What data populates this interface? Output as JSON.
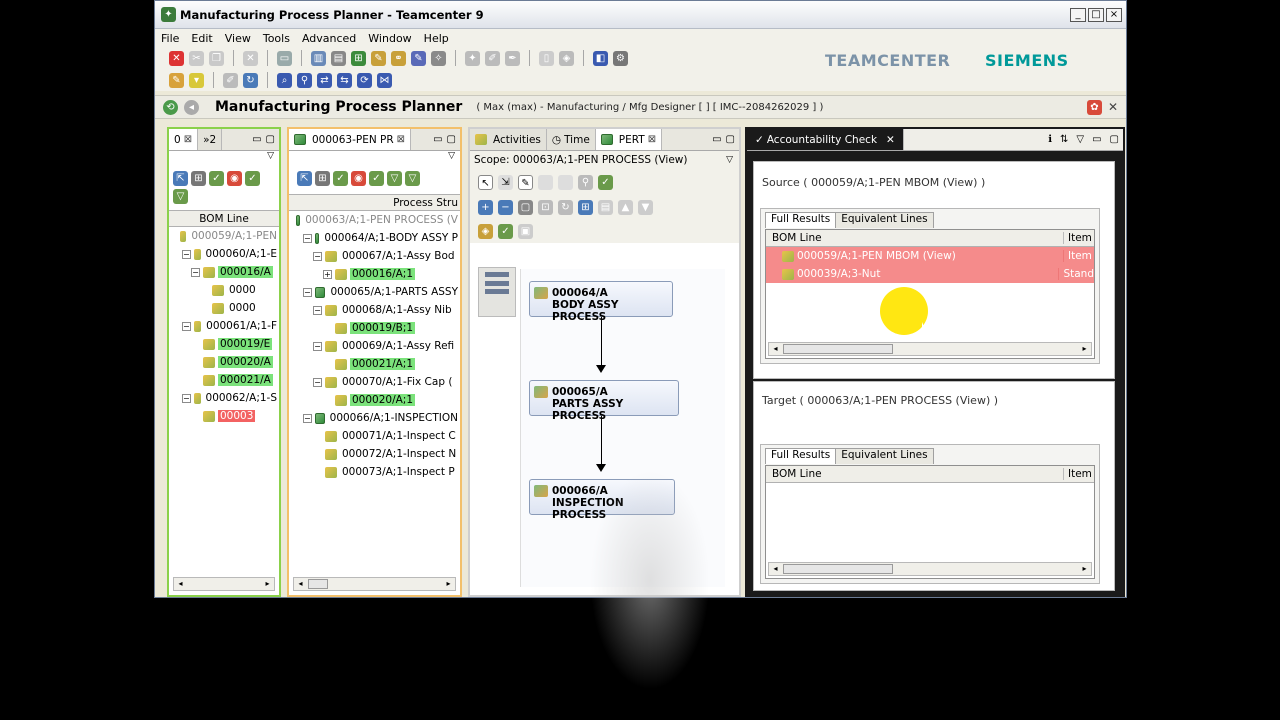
{
  "window": {
    "title": "Manufacturing Process Planner - Teamcenter 9"
  },
  "menu": [
    "File",
    "Edit",
    "View",
    "Tools",
    "Advanced",
    "Window",
    "Help"
  ],
  "brand": {
    "product": "TEAMCENTER",
    "company": "SIEMENS"
  },
  "appbar": {
    "name": "Manufacturing Process Planner",
    "context": "( Max (max) - Manufacturing / Mfg Designer   [ ]   [ IMC--2084262029 ] )"
  },
  "pane1": {
    "tabs": [
      "0",
      "»2"
    ],
    "header": "BOM Line",
    "rows": [
      {
        "label": "000059/A;1-PEN",
        "indent": 0,
        "style": "grey"
      },
      {
        "label": "000060/A;1-E",
        "indent": 1,
        "toggle": "−"
      },
      {
        "label": "000016/A",
        "indent": 2,
        "toggle": "−",
        "style": "green"
      },
      {
        "label": "0000",
        "indent": 3
      },
      {
        "label": "0000",
        "indent": 3
      },
      {
        "label": "000061/A;1-F",
        "indent": 1,
        "toggle": "−"
      },
      {
        "label": "000019/E",
        "indent": 2,
        "style": "green"
      },
      {
        "label": "000020/A",
        "indent": 2,
        "style": "green"
      },
      {
        "label": "000021/A",
        "indent": 2,
        "style": "green"
      },
      {
        "label": "000062/A;1-S",
        "indent": 1,
        "toggle": "−"
      },
      {
        "label": "00003",
        "indent": 2,
        "style": "red"
      }
    ]
  },
  "pane2": {
    "tab": "000063-PEN PR",
    "header": "Process Stru",
    "rows": [
      {
        "label": "000063/A;1-PEN PROCESS (V",
        "indent": 0,
        "style": "grey"
      },
      {
        "label": "000064/A;1-BODY ASSY P",
        "indent": 1,
        "toggle": "−"
      },
      {
        "label": "000067/A;1-Assy Bod",
        "indent": 2,
        "toggle": "−"
      },
      {
        "label": "000016/A;1",
        "indent": 3,
        "toggle": "+",
        "style": "green"
      },
      {
        "label": "000065/A;1-PARTS ASSY",
        "indent": 1,
        "toggle": "−"
      },
      {
        "label": "000068/A;1-Assy Nib",
        "indent": 2,
        "toggle": "−"
      },
      {
        "label": "000019/B;1",
        "indent": 3,
        "style": "green"
      },
      {
        "label": "000069/A;1-Assy Refi",
        "indent": 2,
        "toggle": "−"
      },
      {
        "label": "000021/A;1",
        "indent": 3,
        "style": "green"
      },
      {
        "label": "000070/A;1-Fix Cap (",
        "indent": 2,
        "toggle": "−"
      },
      {
        "label": "000020/A;1",
        "indent": 3,
        "style": "green"
      },
      {
        "label": "000066/A;1-INSPECTION",
        "indent": 1,
        "toggle": "−"
      },
      {
        "label": "000071/A;1-Inspect C",
        "indent": 2
      },
      {
        "label": "000072/A;1-Inspect N",
        "indent": 2
      },
      {
        "label": "000073/A;1-Inspect P",
        "indent": 2
      }
    ]
  },
  "pane3": {
    "tabs": [
      "Activities",
      "Time",
      "PERT"
    ],
    "scope": "Scope: 000063/A;1-PEN PROCESS (View)",
    "nodes": [
      {
        "id": "000064/A",
        "name": "BODY ASSY PROCESS"
      },
      {
        "id": "000065/A",
        "name": "PARTS ASSY PROCESS"
      },
      {
        "id": "000066/A",
        "name": "INSPECTION PROCESS"
      }
    ]
  },
  "pane4": {
    "tab": "Accountability Check",
    "source": {
      "title": "Source ( 000059/A;1-PEN MBOM (View) )",
      "tabs": [
        "Full Results",
        "Equivalent Lines"
      ],
      "columns": [
        "BOM Line",
        "Item"
      ],
      "rows": [
        {
          "bom": "000059/A;1-PEN MBOM (View)",
          "item": "Item"
        },
        {
          "bom": "000039/A;3-Nut",
          "item": "Stand"
        }
      ]
    },
    "target": {
      "title": "Target ( 000063/A;1-PEN PROCESS (View) )",
      "tabs": [
        "Full Results",
        "Equivalent Lines"
      ],
      "columns": [
        "BOM Line",
        "Item"
      ]
    }
  },
  "colors": {
    "highlight_green": "#7be27b",
    "highlight_red": "#f36262",
    "pane_border": "#f3c06a",
    "active_pane_border": "#8bd14a"
  }
}
